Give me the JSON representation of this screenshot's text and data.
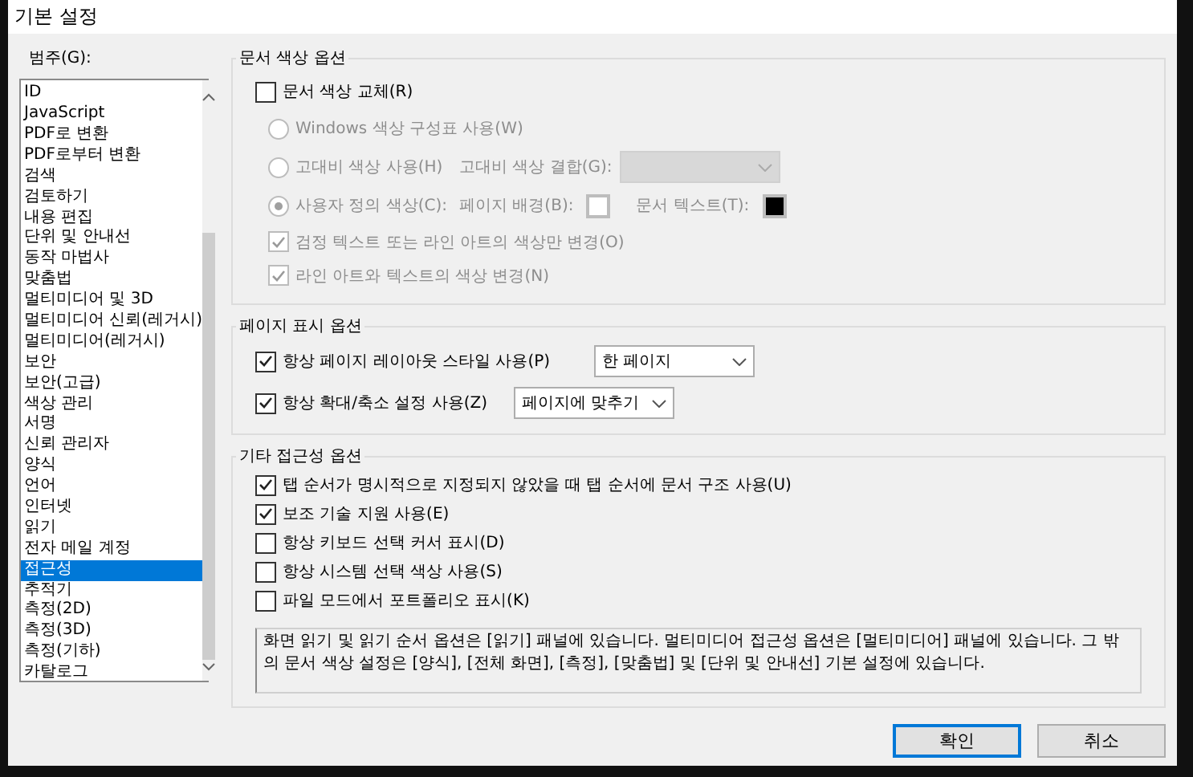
{
  "window": {
    "title": "기본 설정"
  },
  "categories": {
    "label": "범주(G):",
    "items": [
      {
        "label": "ID",
        "selected": false
      },
      {
        "label": "JavaScript",
        "selected": false
      },
      {
        "label": "PDF로 변환",
        "selected": false
      },
      {
        "label": "PDF로부터 변환",
        "selected": false
      },
      {
        "label": "검색",
        "selected": false
      },
      {
        "label": "검토하기",
        "selected": false
      },
      {
        "label": "내용 편집",
        "selected": false
      },
      {
        "label": "단위 및 안내선",
        "selected": false
      },
      {
        "label": "동작 마법사",
        "selected": false
      },
      {
        "label": "맞춤법",
        "selected": false
      },
      {
        "label": "멀티미디어 및 3D",
        "selected": false
      },
      {
        "label": "멀티미디어 신뢰(레거시)",
        "selected": false
      },
      {
        "label": "멀티미디어(레거시)",
        "selected": false
      },
      {
        "label": "보안",
        "selected": false
      },
      {
        "label": "보안(고급)",
        "selected": false
      },
      {
        "label": "색상 관리",
        "selected": false
      },
      {
        "label": "서명",
        "selected": false
      },
      {
        "label": "신뢰 관리자",
        "selected": false
      },
      {
        "label": "양식",
        "selected": false
      },
      {
        "label": "언어",
        "selected": false
      },
      {
        "label": "인터넷",
        "selected": false
      },
      {
        "label": "읽기",
        "selected": false
      },
      {
        "label": "전자 메일 계정",
        "selected": false
      },
      {
        "label": "접근성",
        "selected": true
      },
      {
        "label": "추적기",
        "selected": false
      },
      {
        "label": "측정(2D)",
        "selected": false
      },
      {
        "label": "측정(3D)",
        "selected": false
      },
      {
        "label": "측정(기하)",
        "selected": false
      },
      {
        "label": "카탈로그",
        "selected": false
      }
    ]
  },
  "color_options": {
    "title": "문서 색상 옵션",
    "replace": {
      "label": "문서 색상 교체(R)",
      "checked": false
    },
    "radios": [
      {
        "kind": "plain",
        "label": "Windows 색상 구성표 사용(W)",
        "selected": false,
        "disabled": true
      },
      {
        "kind": "combo",
        "label": "고대비 색상 사용(H)",
        "selected": false,
        "disabled": true,
        "combo_label": "고대비 색상 결합(G):"
      },
      {
        "kind": "swatches",
        "label": "사용자 정의 색상(C):",
        "selected": true,
        "disabled": true,
        "swatches": [
          {
            "label": "페이지 배경(B):",
            "color": "#ffffff"
          },
          {
            "label": "문서 텍스트(T):",
            "color": "#000000"
          }
        ]
      }
    ],
    "checkboxes": [
      {
        "label": "검정 텍스트 또는 라인 아트의 색상만 변경(O)",
        "checked": true,
        "disabled": true
      },
      {
        "label": "라인 아트와 텍스트의 색상 변경(N)",
        "checked": true,
        "disabled": true
      }
    ]
  },
  "page_display": {
    "title": "페이지 표시 옵션",
    "rows": [
      {
        "label": "항상 페이지 레이아웃 스타일 사용(P)",
        "checked": true,
        "value": "한 페이지"
      },
      {
        "label": "항상 확대/축소 설정 사용(Z)",
        "checked": true,
        "value": "페이지에 맞추기"
      }
    ]
  },
  "other": {
    "title": "기타 접근성 옵션",
    "checkboxes": [
      {
        "label": "탭 순서가 명시적으로 지정되지 않았을 때 탭 순서에 문서 구조 사용(U)",
        "checked": true
      },
      {
        "label": "보조 기술 지원 사용(E)",
        "checked": true
      },
      {
        "label": "항상 키보드 선택 커서 표시(D)",
        "checked": false
      },
      {
        "label": "항상 시스템 선택 색상 사용(S)",
        "checked": false
      },
      {
        "label": "파일 모드에서 포트폴리오 표시(K)",
        "checked": false
      }
    ],
    "note": "화면 읽기 및 읽기 순서 옵션은 [읽기] 패널에 있습니다. 멀티미디어 접근성 옵션은 [멀티미디어] 패널에 있습니다. 그 밖의 문서 색상 설정은 [양식], [전체 화면], [측정], [맞춤법] 및 [단위 및 안내선] 기본 설정에 있습니다."
  },
  "buttons": [
    {
      "label": "확인",
      "default": true
    },
    {
      "label": "취소",
      "default": false
    }
  ]
}
